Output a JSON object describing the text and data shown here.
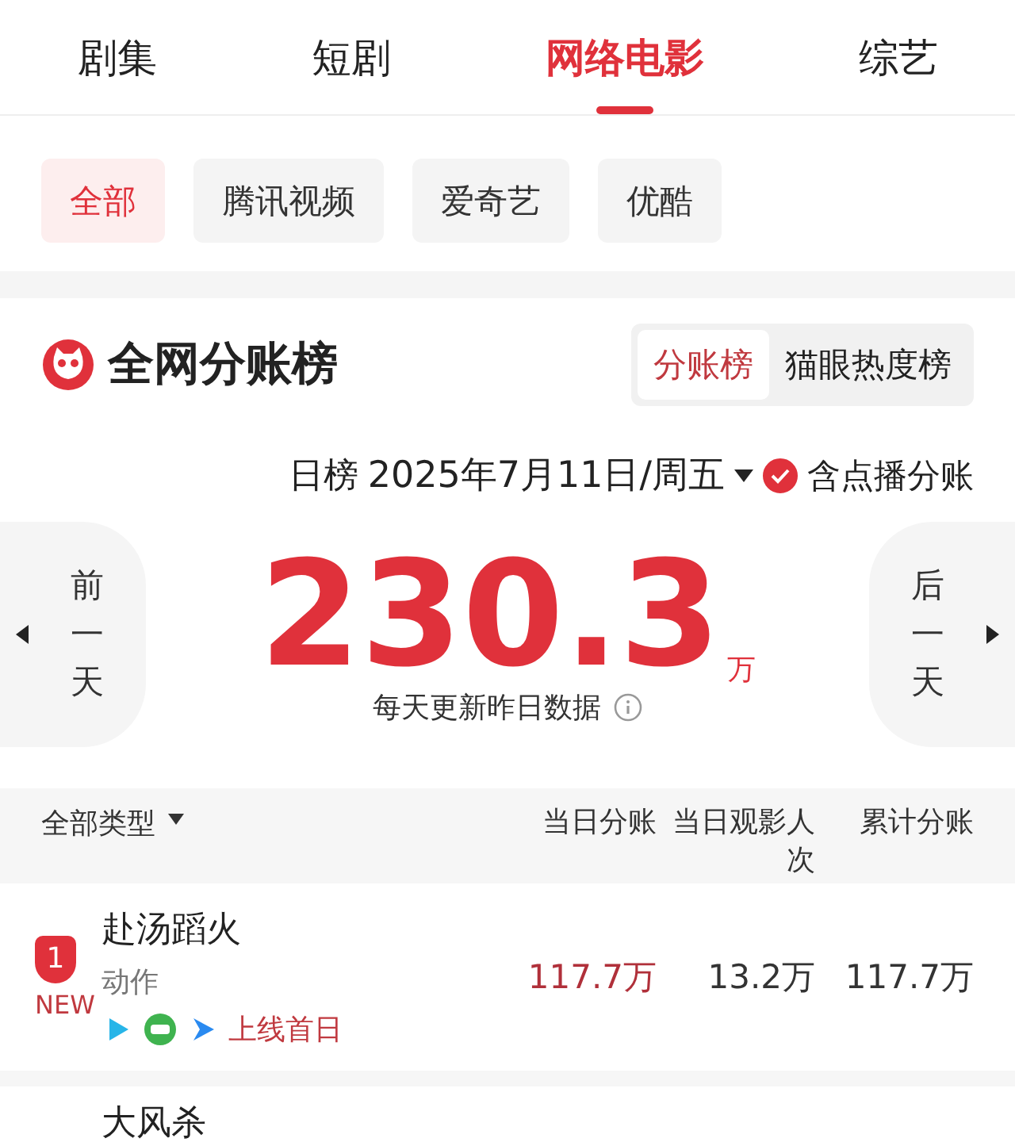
{
  "tabs": [
    {
      "label": "剧集",
      "selected": false
    },
    {
      "label": "短剧",
      "selected": false
    },
    {
      "label": "网络电影",
      "selected": true
    },
    {
      "label": "综艺",
      "selected": false
    }
  ],
  "platforms": [
    {
      "label": "全部",
      "selected": true
    },
    {
      "label": "腾讯视频",
      "selected": false
    },
    {
      "label": "爱奇艺",
      "selected": false
    },
    {
      "label": "优酷",
      "selected": false
    }
  ],
  "board": {
    "title": "全网分账榜",
    "modes": [
      {
        "label": "分账榜",
        "selected": true
      },
      {
        "label": "猫眼热度榜",
        "selected": false
      }
    ],
    "period": "日榜",
    "date": "2025年7月11日/周五",
    "include_vod": {
      "label": "含点播分账",
      "checked": true
    },
    "prev": "前一天",
    "next": "后一天",
    "total": "230.3",
    "unit": "万",
    "note": "每天更新昨日数据"
  },
  "table": {
    "filter": "全部类型",
    "columns": [
      "当日分账",
      "当日观影人次",
      "累计分账"
    ],
    "rows": [
      {
        "rank": "1",
        "badge": "NEW",
        "title": "赴汤蹈火",
        "genre": "动作",
        "tag": "上线首日",
        "cells": [
          "117.7万",
          "13.2万",
          "117.7万"
        ]
      },
      {
        "title": "大风杀"
      }
    ]
  }
}
